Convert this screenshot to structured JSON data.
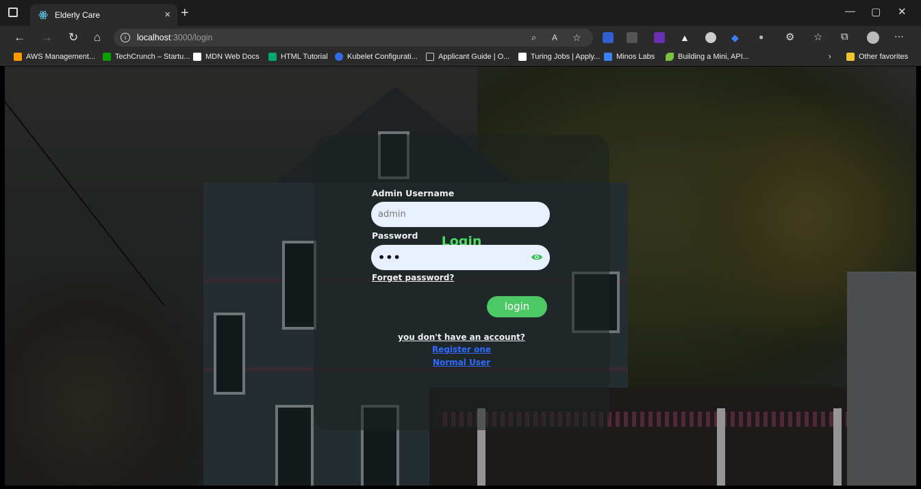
{
  "browser": {
    "tab_title": "Elderly Care",
    "url_host": "localhost",
    "url_path": ":3000/login",
    "new_tab": "+",
    "tab_close": "×"
  },
  "bookmarks": [
    {
      "label": "AWS Management...",
      "color": "#f90"
    },
    {
      "label": "TechCrunch – Startu...",
      "color": "#0a9e01"
    },
    {
      "label": "MDN Web Docs",
      "color": "#fff"
    },
    {
      "label": "HTML Tutorial",
      "color": "#04aa6d"
    },
    {
      "label": "Kubelet Configurati...",
      "color": "#326ce5"
    },
    {
      "label": "Applicant Guide | O...",
      "color": "#ccc"
    },
    {
      "label": "Turing Jobs | Apply...",
      "color": "#fff"
    },
    {
      "label": "Minos Labs",
      "color": "#3b82f6"
    },
    {
      "label": "Building a Mini, API...",
      "color": "#7cc242"
    }
  ],
  "other_favorites": "Other favorites",
  "login": {
    "title": "Login",
    "username_label": "Admin Username",
    "username_value": "admin",
    "password_label": "Password",
    "password_value": "•••",
    "forget_password": "Forget password?",
    "login_button": "login",
    "no_account": "you don't have an account?",
    "register_link": "Register one",
    "normal_user_link": "Normal User"
  },
  "colors": {
    "accent": "#4cc965",
    "link": "#2f6bff"
  }
}
